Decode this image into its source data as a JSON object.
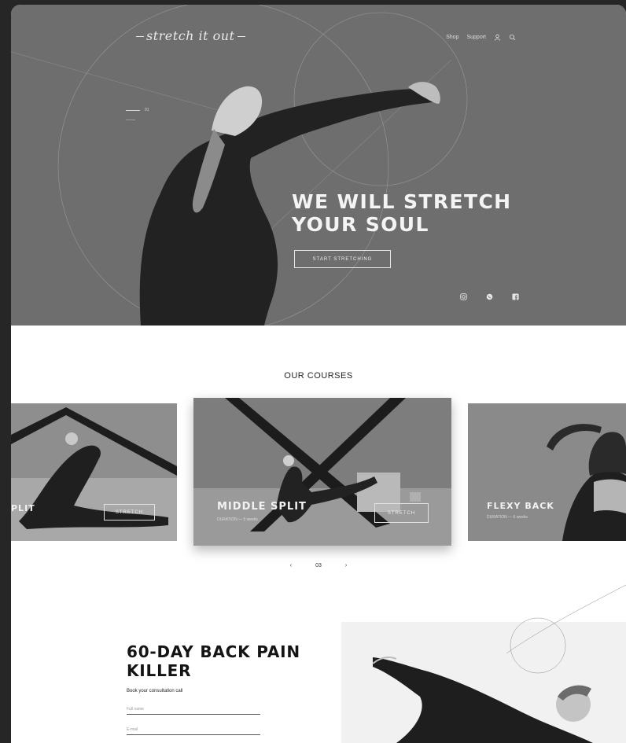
{
  "header": {
    "logo": "stretch it out",
    "nav": [
      "Shop",
      "Support"
    ],
    "icons": [
      "user-icon",
      "search-icon"
    ]
  },
  "hero": {
    "slide_index": "01",
    "title_line1": "WE WILL STRETCH",
    "title_line2": "YOUR SOUL",
    "cta": "START STRETCHING",
    "socials": [
      "instagram-icon",
      "whatsapp-icon",
      "facebook-icon"
    ]
  },
  "courses": {
    "title": "OUR COURSES",
    "cards": [
      {
        "name": "PLIT",
        "duration": "",
        "button": "STRETCH"
      },
      {
        "name": "MIDDLE SPLIT",
        "duration": "DURATION — 5 weeks",
        "button": "STRETCH"
      },
      {
        "name": "FLEXY BACK",
        "duration": "DURATION — 6 weeks",
        "button": ""
      }
    ],
    "pager": {
      "prev": "‹",
      "page": "03",
      "next": "›"
    }
  },
  "promo": {
    "title_line1": "60-DAY BACK PAIN",
    "title_line2": "KILLER",
    "subtitle": "Book your consultation call",
    "fields": [
      {
        "placeholder": "Full name"
      },
      {
        "placeholder": "E-mail"
      }
    ]
  },
  "colors": {
    "hero_bg": "#6e6e6e",
    "text_dark": "#141414",
    "page_bg": "#262626"
  }
}
